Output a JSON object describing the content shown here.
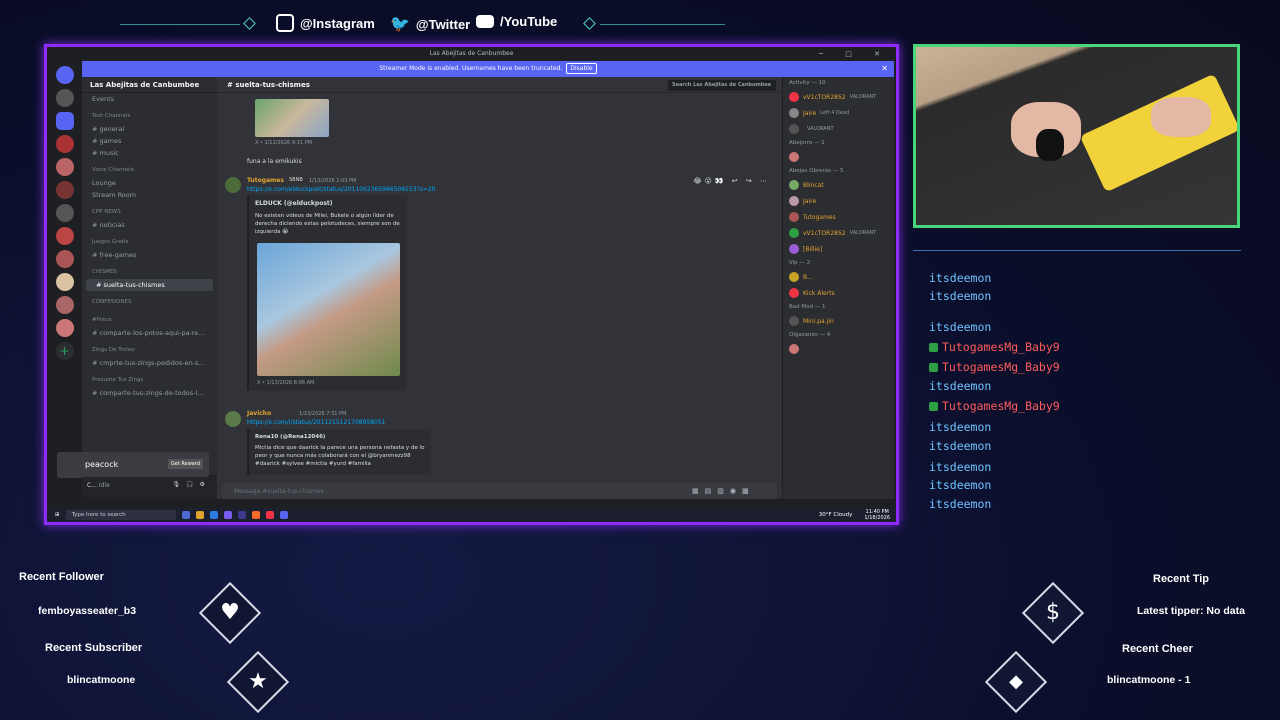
{
  "social": {
    "instagram": "@Instagram",
    "twitter": "@Twitter",
    "youtube": "/YouTube"
  },
  "discord": {
    "window_title": "Las Abejitas de Canbumbee",
    "streamer_banner": "Streamer Mode is enabled. Usernames have been truncated.",
    "disable_label": "Disable",
    "server_name": "Las Abejitas de Canbumbee",
    "channel_name": "suelta-tus-chismes",
    "search_placeholder": "Search Las Abejitas de Canbumbee",
    "channel_list": [
      {
        "type": "item",
        "label": "Events"
      },
      {
        "type": "cat",
        "label": "Text Channels"
      },
      {
        "type": "item",
        "label": "# general"
      },
      {
        "type": "item",
        "label": "# games"
      },
      {
        "type": "item",
        "label": "# music"
      },
      {
        "type": "cat",
        "label": "Voice Channels"
      },
      {
        "type": "item",
        "label": "Lounge"
      },
      {
        "type": "item",
        "label": "Stream Room"
      },
      {
        "type": "cat",
        "label": "CPP NEWS"
      },
      {
        "type": "item",
        "label": "# noticias"
      },
      {
        "type": "cat",
        "label": "Juegos Gratis"
      },
      {
        "type": "item",
        "label": "# free-games"
      },
      {
        "type": "cat",
        "label": "CHISMES"
      },
      {
        "type": "sel",
        "label": "# suelta-tus-chismes"
      },
      {
        "type": "cat",
        "label": "CONFESIONES"
      },
      {
        "type": "cat",
        "label": "#Potos"
      },
      {
        "type": "item",
        "label": "# comparte-los-potos-aqui-pa-re..."
      },
      {
        "type": "cat",
        "label": "Zings De Troleo"
      },
      {
        "type": "item",
        "label": "# cmprte-tus-zings-pedidos-en-s..."
      },
      {
        "type": "cat",
        "label": "Presume Tus Zings"
      },
      {
        "type": "item",
        "label": "# comparte-tus-zings-de-todos-l..."
      }
    ],
    "peacock": {
      "label": "peacock",
      "button": "Get Reward"
    },
    "user": {
      "name": "C...",
      "status": "Idle"
    },
    "messages": {
      "ts1": "X • 1/12/2026 9:31 PM",
      "text1": "funa a la emikukis",
      "author2": "Tutogames",
      "tag2": "SBNB",
      "time2": "1/13/2026 2:03 PM",
      "link2": "https://x.com/elduckpost/status/2011062365966508153?s=20",
      "embed2_author": "ELDUCK (@elduckpost)",
      "embed2_text": "No existen videos de Milei, Bukele o algún líder de derecha diciendo estas pelotudeces, siempre son de izquierda 😭",
      "ts2": "X • 1/13/2026 8:06 AM",
      "author3": "Javicho",
      "time3": "1/13/2026 7:31 PM",
      "link3": "https://x.com/i/status/2011215121708958051",
      "embed3_author": "Rena10 (@Rena12046)",
      "embed3_text": "Mictia dice que daarick la parece una persona nefasta y de lo peor y que nunca más colaborará con el @bryanmezz98 #daarick #sylvee #mictia #yurd #familia"
    },
    "input_placeholder": "Message #suelta-tus-chismes",
    "members": [
      {
        "kind": "head",
        "text": "Activity — 10"
      },
      {
        "kind": "member",
        "name": "vV1cTOR2852",
        "sub": "VALORANT"
      },
      {
        "kind": "member",
        "name": "Jaire",
        "sub": "Left 4 Dead"
      },
      {
        "kind": "member",
        "name": "",
        "sub": "VALORANT"
      },
      {
        "kind": "head",
        "text": "Abejorro — 1"
      },
      {
        "kind": "member",
        "name": "",
        "sub": ""
      },
      {
        "kind": "head",
        "text": "Abejas Obreras — 5"
      },
      {
        "kind": "member",
        "name": "Blincat",
        "sub": ""
      },
      {
        "kind": "member",
        "name": "Jaire",
        "sub": ""
      },
      {
        "kind": "member",
        "name": "Tutogames",
        "sub": ""
      },
      {
        "kind": "member",
        "name": "vV1cTOR2852",
        "sub": "VALORANT"
      },
      {
        "kind": "member",
        "name": "[Billie]",
        "sub": ""
      },
      {
        "kind": "head",
        "text": "Vip — 2"
      },
      {
        "kind": "member",
        "name": "B...",
        "sub": ""
      },
      {
        "kind": "member",
        "name": "Kick Alerts",
        "sub": ""
      },
      {
        "kind": "head",
        "text": "Bad Mod — 1"
      },
      {
        "kind": "member",
        "name": "Mini.pa.jin",
        "sub": ""
      },
      {
        "kind": "head",
        "text": "Olgazanes — 4"
      },
      {
        "kind": "member",
        "name": "",
        "sub": ""
      }
    ],
    "taskbar": {
      "search": "Type here to search",
      "weather": "30°F Cloudy",
      "time": "11:40 PM",
      "date": "1/18/2026"
    }
  },
  "chat": [
    {
      "name": "itsdeemon",
      "color": "blue"
    },
    {
      "name": "itsdeemon",
      "color": "blue"
    },
    {
      "name": "itsdeemon",
      "color": "blue"
    },
    {
      "name": "TutogamesMg_Baby9",
      "color": "red"
    },
    {
      "name": "TutogamesMg_Baby9",
      "color": "red"
    },
    {
      "name": "itsdeemon",
      "color": "blue"
    },
    {
      "name": "TutogamesMg_Baby9",
      "color": "red"
    },
    {
      "name": "itsdeemon",
      "color": "blue"
    },
    {
      "name": "itsdeemon",
      "color": "blue"
    },
    {
      "name": "itsdeemon",
      "color": "blue"
    },
    {
      "name": "itsdeemon",
      "color": "blue"
    },
    {
      "name": "itsdeemon",
      "color": "blue"
    }
  ],
  "alerts": {
    "recent_follower_label": "Recent Follower",
    "recent_follower": "femboyasseater_b3",
    "recent_subscriber_label": "Recent Subscriber",
    "recent_subscriber": "blincatmoone",
    "recent_tip_label": "Recent Tip",
    "recent_tip": "Latest tipper: No data",
    "recent_cheer_label": "Recent Cheer",
    "recent_cheer": "blincatmoone - 1"
  },
  "colors": {
    "accent": "#8f2bff",
    "cam_border": "#49d67a",
    "chat_name": "#6fc3ff",
    "chat_red": "#ff5b5b",
    "discord_blurple": "#5865f2"
  }
}
